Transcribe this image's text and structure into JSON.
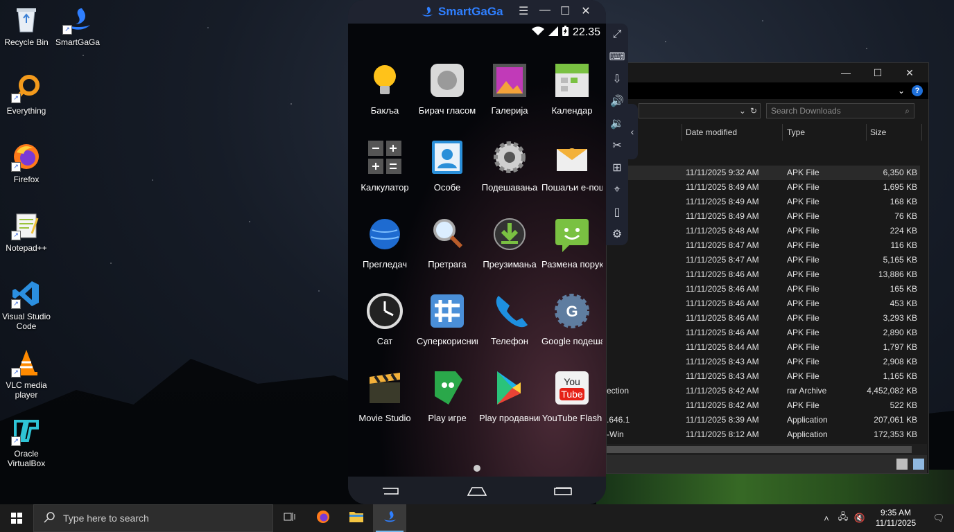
{
  "desktop": {
    "icons": [
      {
        "label": "Recycle Bin"
      },
      {
        "label": "SmartGaGa"
      },
      {
        "label": "Everything"
      },
      {
        "label": "Firefox"
      },
      {
        "label": "Notepad++"
      },
      {
        "label": "Visual Studio Code"
      },
      {
        "label": "VLC media player"
      },
      {
        "label": "Oracle VirtualBox"
      }
    ]
  },
  "emulator": {
    "brand": "SmartGaGa",
    "status_time": "22.35",
    "apps": [
      {
        "label": "Бакља",
        "icon": "flashlight-icon"
      },
      {
        "label": "Бирач гласом",
        "icon": "voice-dialer-icon"
      },
      {
        "label": "Галерија",
        "icon": "gallery-icon"
      },
      {
        "label": "Календар",
        "icon": "calendar-icon"
      },
      {
        "label": "Калкулатор",
        "icon": "calculator-icon"
      },
      {
        "label": "Особе",
        "icon": "contacts-icon"
      },
      {
        "label": "Подешавања",
        "icon": "settings-icon"
      },
      {
        "label": "Пошаљи е-пошту",
        "icon": "email-icon"
      },
      {
        "label": "Прегледач",
        "icon": "browser-icon"
      },
      {
        "label": "Претрага",
        "icon": "search-icon"
      },
      {
        "label": "Преузимања",
        "icon": "downloads-icon"
      },
      {
        "label": "Размена порука",
        "icon": "messaging-icon"
      },
      {
        "label": "Сат",
        "icon": "clock-icon"
      },
      {
        "label": "Суперкорисник",
        "icon": "superuser-icon"
      },
      {
        "label": "Телефон",
        "icon": "phone-icon"
      },
      {
        "label": "Google подешавања",
        "icon": "google-settings-icon"
      },
      {
        "label": "Movie Studio",
        "icon": "movie-studio-icon"
      },
      {
        "label": "Play игре",
        "icon": "play-games-icon"
      },
      {
        "label": "Play продавница",
        "icon": "play-store-icon"
      },
      {
        "label": "YouTube Flash",
        "icon": "youtube-icon"
      }
    ]
  },
  "explorer": {
    "search_placeholder": "Search Downloads",
    "columns": {
      "date": "Date modified",
      "type": "Type",
      "size": "Size"
    },
    "rows": [
      {
        "name": "",
        "date": "11/11/2025 9:32 AM",
        "type": "APK File",
        "size": "6,350 KB"
      },
      {
        "name": "",
        "date": "11/11/2025 8:49 AM",
        "type": "APK File",
        "size": "1,695 KB"
      },
      {
        "name": "",
        "date": "11/11/2025 8:49 AM",
        "type": "APK File",
        "size": "168 KB"
      },
      {
        "name": "",
        "date": "11/11/2025 8:49 AM",
        "type": "APK File",
        "size": "76 KB"
      },
      {
        "name": "",
        "date": "11/11/2025 8:48 AM",
        "type": "APK File",
        "size": "224 KB"
      },
      {
        "name": "",
        "date": "11/11/2025 8:47 AM",
        "type": "APK File",
        "size": "116 KB"
      },
      {
        "name": "",
        "date": "11/11/2025 8:47 AM",
        "type": "APK File",
        "size": "5,165 KB"
      },
      {
        "name": "",
        "date": "11/11/2025 8:46 AM",
        "type": "APK File",
        "size": "13,886 KB"
      },
      {
        "name": "",
        "date": "11/11/2025 8:46 AM",
        "type": "APK File",
        "size": "165 KB"
      },
      {
        "name": "",
        "date": "11/11/2025 8:46 AM",
        "type": "APK File",
        "size": "453 KB"
      },
      {
        "name": "",
        "date": "11/11/2025 8:46 AM",
        "type": "APK File",
        "size": "3,293 KB"
      },
      {
        "name": "",
        "date": "11/11/2025 8:46 AM",
        "type": "APK File",
        "size": "2,890 KB"
      },
      {
        "name": "",
        "date": "11/11/2025 8:44 AM",
        "type": "APK File",
        "size": "1,797 KB"
      },
      {
        "name": "",
        "date": "11/11/2025 8:43 AM",
        "type": "APK File",
        "size": "2,908 KB"
      },
      {
        "name": "",
        "date": "11/11/2025 8:43 AM",
        "type": "APK File",
        "size": "1,165 KB"
      },
      {
        "name": "ection",
        "date": "11/11/2025 8:42 AM",
        "type": "rar Archive",
        "size": "4,452,082 KB"
      },
      {
        "name": "",
        "date": "11/11/2025 8:42 AM",
        "type": "APK File",
        "size": "522 KB"
      },
      {
        "name": ".646.1",
        "date": "11/11/2025 8:39 AM",
        "type": "Application",
        "size": "207,061 KB"
      },
      {
        "name": "-Win",
        "date": "11/11/2025 8:12 AM",
        "type": "Application",
        "size": "172,353 KB"
      }
    ]
  },
  "taskbar": {
    "search_placeholder": "Type here to search",
    "time": "9:35 AM",
    "date": "11/11/2025"
  },
  "colors": {
    "smartgaga_blue": "#2f7fff",
    "taskbar_bg": "#1c1c1c",
    "explorer_bg": "#191919"
  }
}
